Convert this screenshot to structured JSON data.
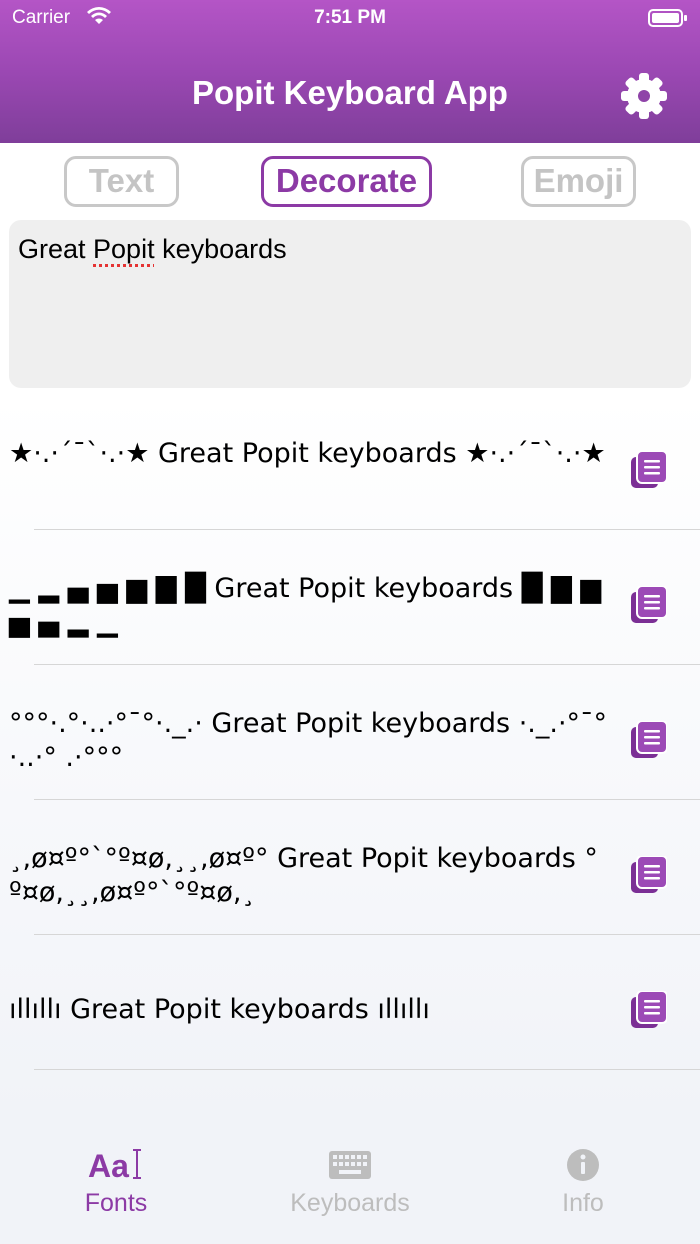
{
  "status_bar": {
    "carrier": "Carrier",
    "time": "7:51 PM"
  },
  "nav": {
    "title": "Popit Keyboard App",
    "settings_icon": "gear-icon"
  },
  "segments": [
    {
      "label": "Text",
      "active": false
    },
    {
      "label": "Decorate",
      "active": true
    },
    {
      "label": "Emoji",
      "active": false
    }
  ],
  "input": {
    "before": "Great ",
    "misspelled": "Popit",
    "after": " keyboards"
  },
  "results": [
    {
      "text": "★·.·´¯`·.·★ Great Popit keyboards ★·.·´¯`·.·★"
    },
    {
      "text": "▁ ▂ ▄ ▅ ▆ ▇ █ Great Popit keyboards █ ▇ ▆ ▅ ▄ ▂ ▁"
    },
    {
      "text": "°°°·.°·..·°¯°·._.· Great Popit keyboards ·._.·°¯°·..·° .·°°°"
    },
    {
      "text": "¸,ø¤º°`°º¤ø,¸¸,ø¤º° Great Popit keyboards °º¤ø,¸¸,ø¤º°`°º¤ø,¸"
    },
    {
      "text": "ıllıllı Great Popit keyboards ıllıllı"
    }
  ],
  "tabbar": {
    "fonts": "Fonts",
    "keyboards": "Keyboards",
    "info": "Info"
  },
  "colors": {
    "accent": "#8c3aa5",
    "header_top": "#b455c6",
    "header_bottom": "#7f3e9a",
    "inactive": "#bdbdbd"
  }
}
